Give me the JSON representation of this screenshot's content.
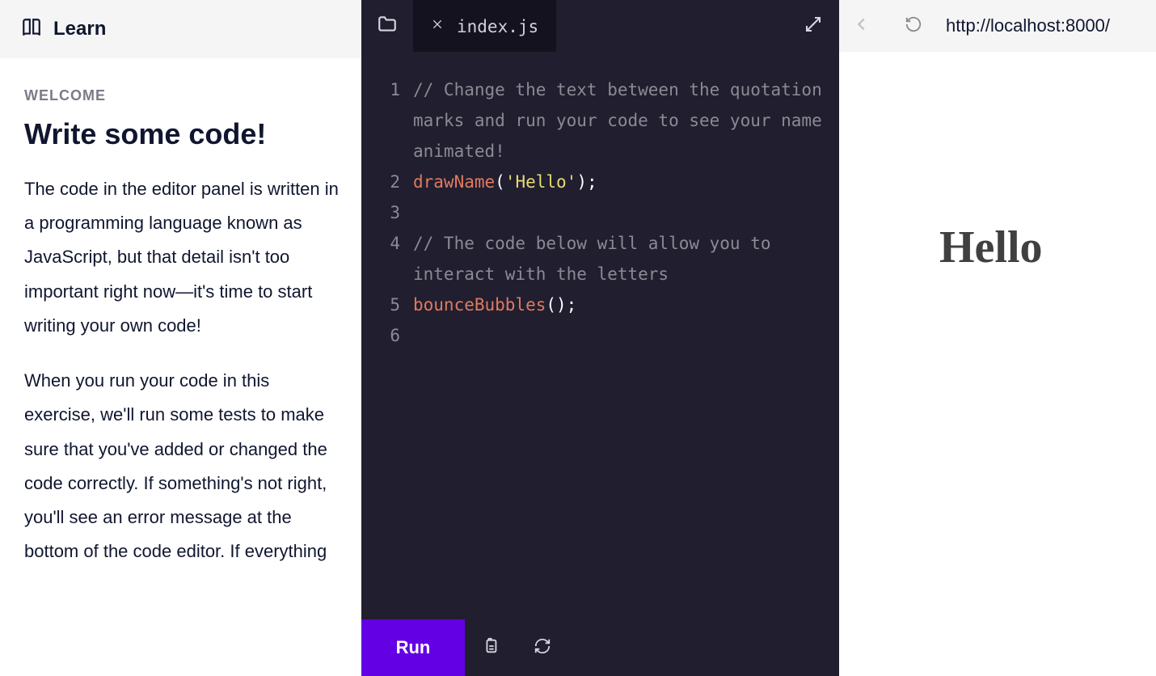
{
  "learn": {
    "header_title": "Learn",
    "eyebrow": "WELCOME",
    "title": "Write some code!",
    "para1": "The code in the editor panel is written in a programming language known as JavaScript, but that detail isn't too important right now—it's time to start writing your own code!",
    "para2": "When you run your code in this exercise, we'll run some tests to make sure that you've added or changed the code correctly. If something's not right, you'll see an error message at the bottom of the code editor. If everything"
  },
  "editor": {
    "tab_filename": "index.js",
    "run_label": "Run",
    "lines": {
      "l1": "// Change the text between the quotation marks and run your code to see your name animated!",
      "l2_call": "drawName",
      "l2_open": "(",
      "l2_str": "'Hello'",
      "l2_close": ");",
      "l4": "// The code below will allow you to interact with the letters",
      "l5_call": "bounceBubbles",
      "l5_rest": "();"
    },
    "gutter": [
      "1",
      "2",
      "3",
      "4",
      "5",
      "6"
    ]
  },
  "preview": {
    "url": "http://localhost:8000/",
    "output_text": "Hello"
  }
}
